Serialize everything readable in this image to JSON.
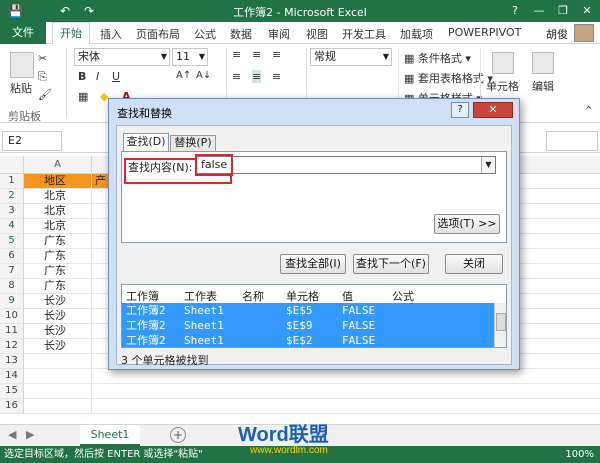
{
  "window": {
    "title": "工作簿2 - Microsoft Excel",
    "help": "?",
    "minimize": "—",
    "restore": "❐",
    "close": "✕",
    "quick_access": [
      "💾",
      "↶",
      "↷"
    ]
  },
  "ribbon": {
    "file_tab": "文件",
    "tabs": [
      "开始",
      "插入",
      "页面布局",
      "公式",
      "数据",
      "审阅",
      "视图",
      "开发工具",
      "加载项",
      "POWERPIVOT"
    ],
    "user": "胡俊",
    "clipboard_paste": "粘贴",
    "clipboard_group": "剪贴板",
    "font_name": "宋体",
    "font_size": "11",
    "number_format": "常规",
    "conditional_format": "条件格式",
    "table_format": "套用表格格式",
    "cell_styles": "单元格样式",
    "cells": "单元格",
    "editing": "编辑"
  },
  "formula_bar": {
    "name_box": "E2",
    "fx": "fx"
  },
  "sheet": {
    "column_a": "A",
    "header_a1": "地区",
    "header_b1": "产",
    "rows": [
      {
        "n": "1",
        "a": "地区"
      },
      {
        "n": "2",
        "a": "北京"
      },
      {
        "n": "3",
        "a": "北京"
      },
      {
        "n": "4",
        "a": "北京"
      },
      {
        "n": "5",
        "a": "广东"
      },
      {
        "n": "6",
        "a": "广东"
      },
      {
        "n": "7",
        "a": "广东"
      },
      {
        "n": "8",
        "a": "广东"
      },
      {
        "n": "9",
        "a": "长沙"
      },
      {
        "n": "10",
        "a": "长沙"
      },
      {
        "n": "11",
        "a": "长沙"
      },
      {
        "n": "12",
        "a": "长沙"
      },
      {
        "n": "13",
        "a": ""
      },
      {
        "n": "14",
        "a": ""
      },
      {
        "n": "15",
        "a": ""
      },
      {
        "n": "16",
        "a": ""
      }
    ],
    "tab_name": "Sheet1",
    "add_sheet": "+"
  },
  "status_bar": {
    "message": "选定目标区域，然后按 ENTER 或选择\"粘贴\"",
    "zoom": "100%"
  },
  "watermark": {
    "brand": "Word联盟",
    "url": "www.wordlm.com"
  },
  "dialog": {
    "title": "查找和替换",
    "help": "?",
    "close": "✕",
    "tab_find": "查找(D)",
    "tab_replace": "替换(P)",
    "find_label": "查找内容(N):",
    "find_value": "false",
    "options_button": "选项(T) >>",
    "find_all": "查找全部(I)",
    "find_next": "查找下一个(F)",
    "close_button": "关闭",
    "results_headers": [
      "工作簿",
      "工作表",
      "名称",
      "单元格",
      "值",
      "公式"
    ],
    "results": [
      {
        "book": "工作簿2",
        "sheet": "Sheet1",
        "name": "",
        "cell": "$E$5",
        "value": "FALSE",
        "formula": ""
      },
      {
        "book": "工作簿2",
        "sheet": "Sheet1",
        "name": "",
        "cell": "$E$9",
        "value": "FALSE",
        "formula": ""
      },
      {
        "book": "工作簿2",
        "sheet": "Sheet1",
        "name": "",
        "cell": "$E$2",
        "value": "FALSE",
        "formula": ""
      }
    ],
    "status": "3 个单元格被找到"
  },
  "colors": {
    "excel_green": "#217346",
    "header_orange": "#f7941d",
    "selection_blue": "#3399ff",
    "highlight_red": "#e0232f"
  }
}
